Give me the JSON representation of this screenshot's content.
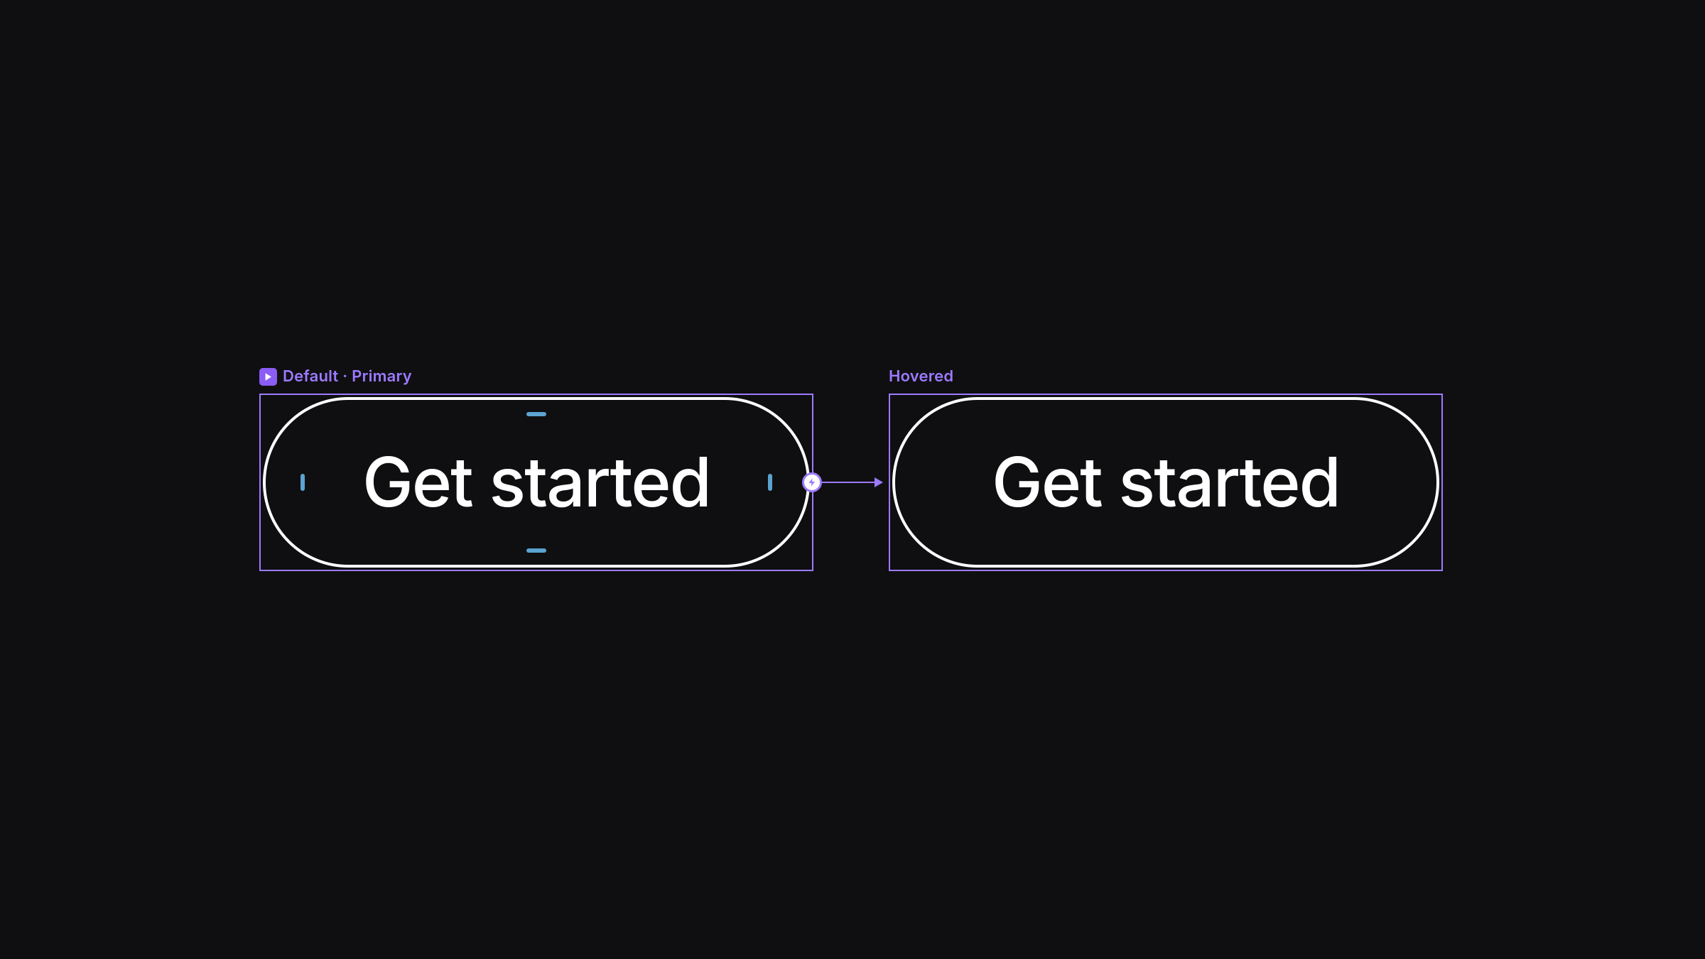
{
  "canvas": {
    "frames": [
      {
        "label": "Default · Primary",
        "has_play_icon": true,
        "button_text": "Get started",
        "selected": true,
        "shows_padding_handles": true
      },
      {
        "label": "Hovered",
        "has_play_icon": false,
        "button_text": "Get started",
        "selected": false,
        "shows_padding_handles": false
      }
    ],
    "prototype_connection": {
      "from_frame": 0,
      "to_frame": 1,
      "icon": "lightning-bolt"
    }
  },
  "colors": {
    "background": "#0f0f11",
    "selection": "#9d7aff",
    "button_stroke": "#ffffff",
    "button_text": "#ffffff",
    "padding_handle": "#5ba3d0"
  }
}
